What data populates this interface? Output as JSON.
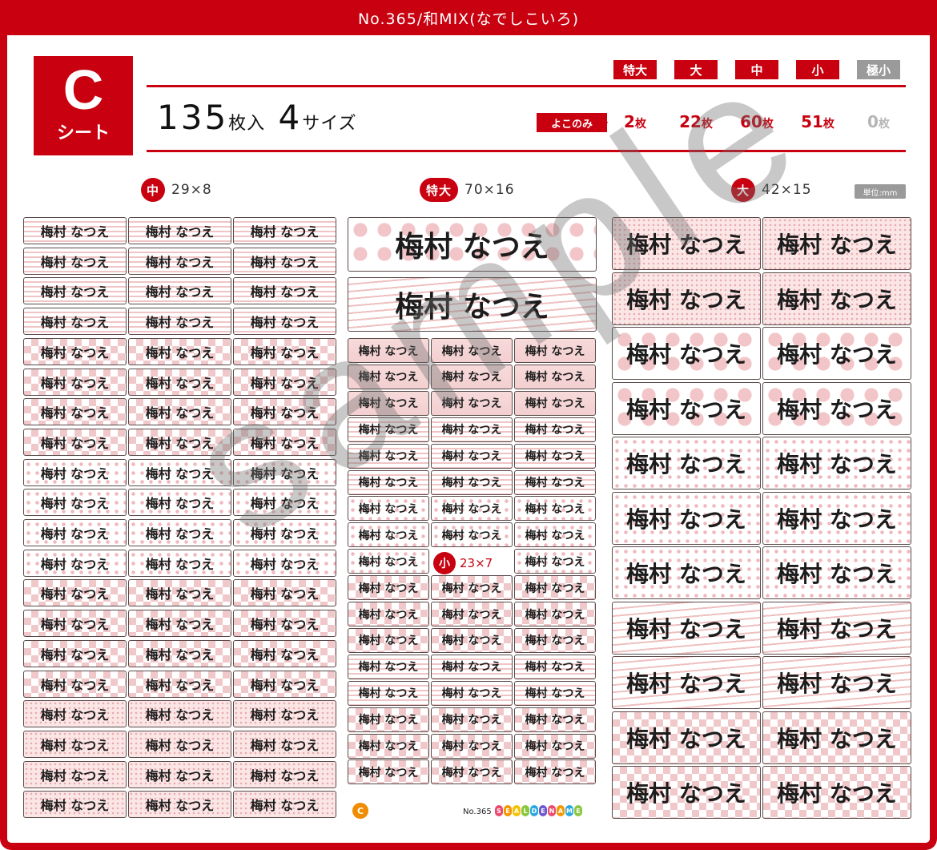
{
  "header": {
    "title": "No.365/和MIX(なでしこいろ)"
  },
  "sheet": {
    "letter": "C",
    "word": "シート"
  },
  "count": {
    "total": "135",
    "total_unit": "枚入",
    "sizes": "4",
    "sizes_unit": "サイズ"
  },
  "size_tabs": [
    "特大",
    "大",
    "中",
    "小",
    "極小"
  ],
  "orientation_label": "よこのみ",
  "counts": [
    {
      "value": "2",
      "unit": "枚"
    },
    {
      "value": "22",
      "unit": "枚"
    },
    {
      "value": "60",
      "unit": "枚"
    },
    {
      "value": "51",
      "unit": "枚"
    },
    {
      "value": "0",
      "unit": "枚"
    }
  ],
  "sections": {
    "medium": {
      "badge": "中",
      "dims": "29×8"
    },
    "xlarge": {
      "badge": "特大",
      "dims": "70×16"
    },
    "large": {
      "badge": "大",
      "dims": "42×15"
    },
    "small": {
      "badge": "小",
      "dims": "23×7"
    }
  },
  "unit_label": "単位:mm",
  "label_text": "梅村 なつえ",
  "watermark": "sample",
  "footer": {
    "sheet_mark": "C",
    "number": "No.365",
    "logo": "SEALDENAME"
  },
  "colors": {
    "brand_red": "#c8000f",
    "pattern_pink": "#f1c8ca",
    "disabled_gray": "#9a9a9a"
  }
}
